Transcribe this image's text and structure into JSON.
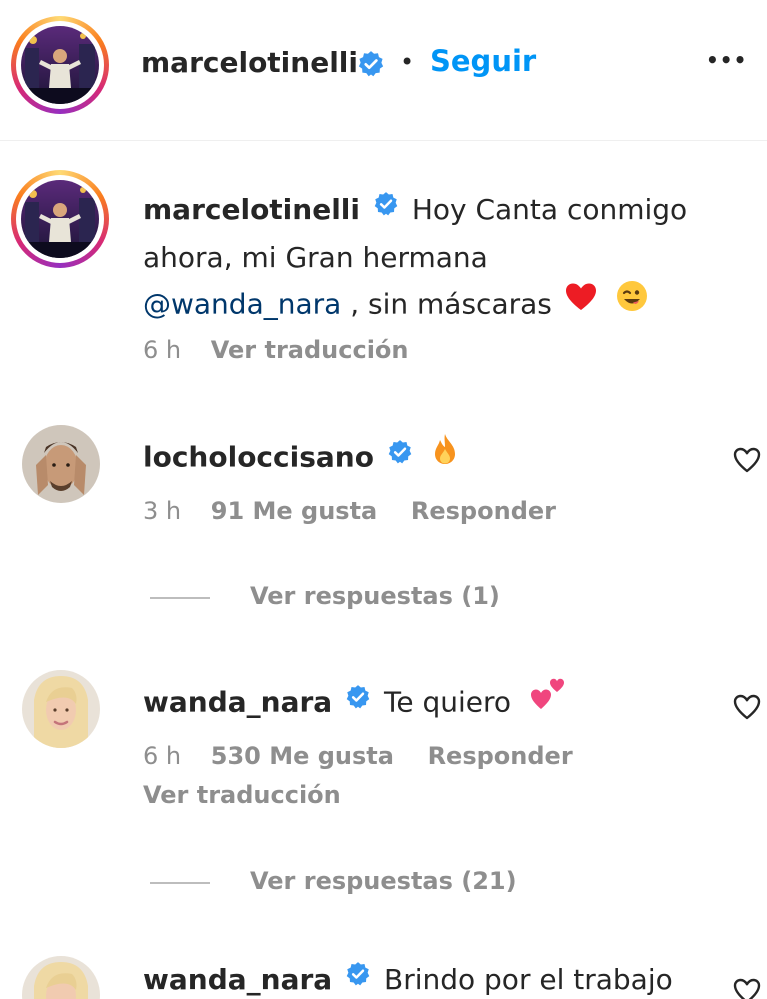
{
  "header": {
    "username": "marcelotinelli",
    "separator": "•",
    "follow_label": "Seguir",
    "more_label": "•••"
  },
  "caption": {
    "username": "marcelotinelli",
    "text_part1": "Hoy Canta conmigo",
    "text_part2": "ahora, mi Gran hermana",
    "mention": "@wanda_nara",
    "text_part3": " , sin máscaras",
    "time": "6 h",
    "translate_label": "Ver traducción"
  },
  "comments": [
    {
      "username": "locholoccisano",
      "text": "",
      "emoji": "fire",
      "time": "3 h",
      "likes": "91 Me gusta",
      "reply_label": "Responder",
      "replies_label": "Ver respuestas (1)"
    },
    {
      "username": "wanda_nara",
      "text": "Te quiero",
      "emoji": "two-hearts",
      "time": "6 h",
      "likes": "530 Me gusta",
      "reply_label": "Responder",
      "translate_label": "Ver traducción",
      "replies_label": "Ver respuestas (21)"
    },
    {
      "username": "wanda_nara",
      "text": "Brindo por el trabajo"
    }
  ],
  "colors": {
    "accent": "#0095f6",
    "verified": "#3897f0",
    "muted": "#8e8e8e",
    "text": "#262626",
    "heart_red": "#ed1c24"
  }
}
